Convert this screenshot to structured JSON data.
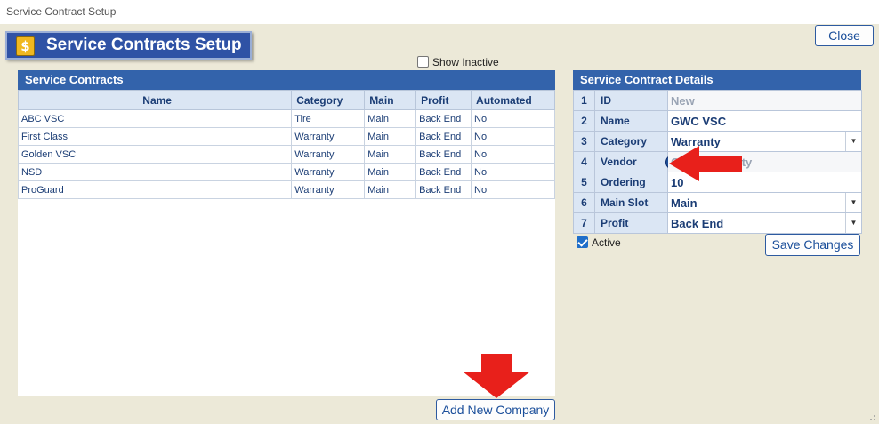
{
  "window": {
    "title": "Service Contract Setup"
  },
  "header": {
    "title": "Service Contracts Setup",
    "icon": "dollar-document-icon",
    "icon_glyph": "$"
  },
  "toolbar": {
    "close_label": "Close"
  },
  "filter": {
    "show_inactive_label": "Show Inactive",
    "show_inactive_checked": false
  },
  "contracts": {
    "title": "Service Contracts",
    "columns": [
      "Name",
      "Category",
      "Main",
      "Profit",
      "Automated"
    ],
    "rows": [
      {
        "name": "ABC VSC",
        "category": "Tire",
        "main": "Main",
        "profit": "Back End",
        "automated": "No"
      },
      {
        "name": "First Class",
        "category": "Warranty",
        "main": "Main",
        "profit": "Back End",
        "automated": "No"
      },
      {
        "name": "Golden VSC",
        "category": "Warranty",
        "main": "Main",
        "profit": "Back End",
        "automated": "No"
      },
      {
        "name": "NSD",
        "category": "Warranty",
        "main": "Main",
        "profit": "Back End",
        "automated": "No"
      },
      {
        "name": "ProGuard",
        "category": "Warranty",
        "main": "Main",
        "profit": "Back End",
        "automated": "No"
      }
    ],
    "add_label": "Add New Company"
  },
  "details": {
    "title": "Service Contract Details",
    "fields": [
      {
        "num": "1",
        "label": "ID",
        "value": "New"
      },
      {
        "num": "2",
        "label": "Name",
        "value": "GWC VSC"
      },
      {
        "num": "3",
        "label": "Category",
        "value": "Warranty"
      },
      {
        "num": "4",
        "label": "Vendor",
        "value": "GWC Warranty"
      },
      {
        "num": "5",
        "label": "Ordering",
        "value": "10"
      },
      {
        "num": "6",
        "label": "Main Slot",
        "value": "Main"
      },
      {
        "num": "7",
        "label": "Profit",
        "value": "Back End"
      }
    ],
    "active_label": "Active",
    "active_checked": true,
    "save_label": "Save Changes"
  },
  "colors": {
    "header_blue": "#3363ab",
    "annotation_red": "#e8201b",
    "link_blue": "#1a4e9a"
  }
}
